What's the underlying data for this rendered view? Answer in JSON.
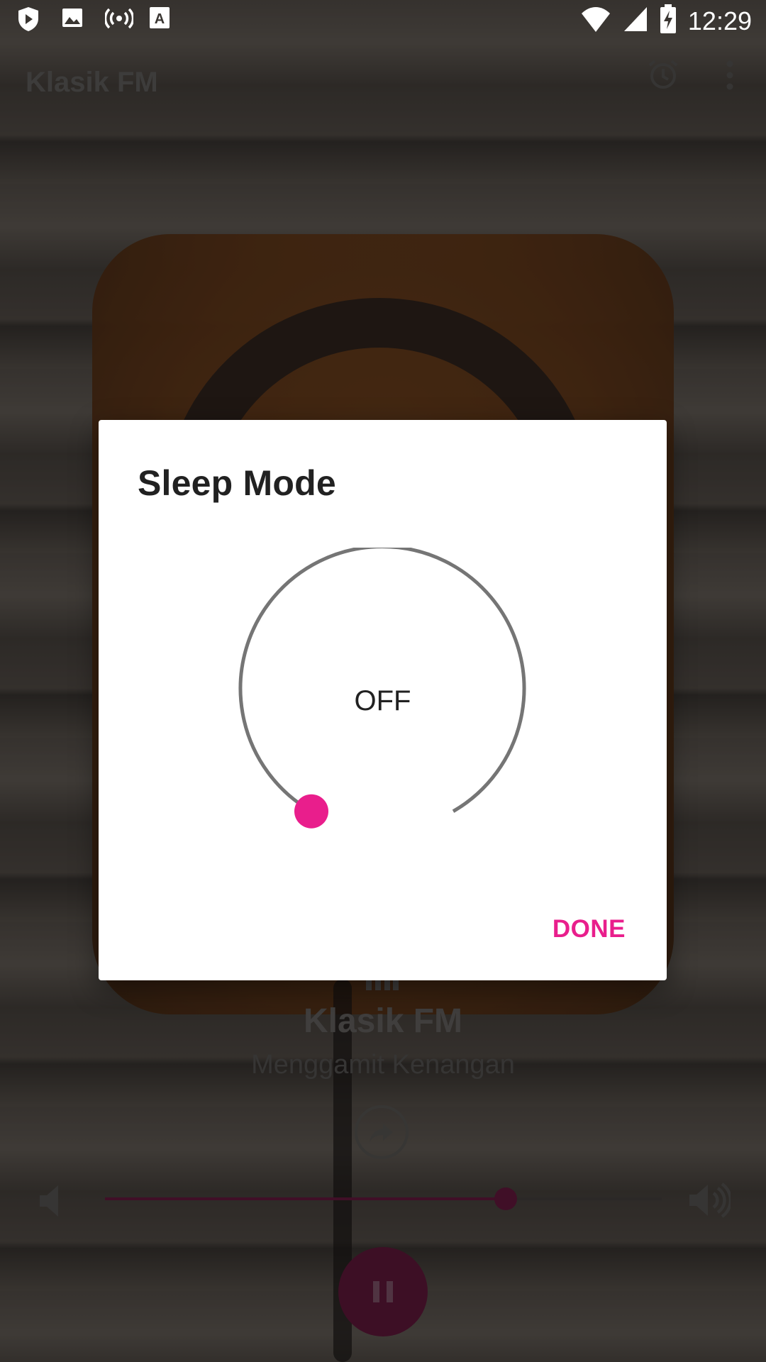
{
  "status_bar": {
    "time": "12:29",
    "left_icons": [
      "shield-play-icon",
      "image-icon",
      "radio-broadcast-icon",
      "keyboard-a-icon"
    ],
    "right_icons": [
      "wifi-icon",
      "cellular-signal-icon",
      "battery-charging-icon"
    ]
  },
  "toolbar": {
    "title": "Klasik FM",
    "icons": [
      "alarm-icon",
      "more-vert-icon"
    ]
  },
  "player": {
    "station_name": "Klasik FM",
    "subtitle": "Menggamit Kenangan",
    "volume_fraction": 0.72,
    "icons": [
      "share-icon",
      "volume-low-icon",
      "volume-high-icon",
      "pause-icon",
      "equalizer-bars-icon"
    ]
  },
  "dialog": {
    "title": "Sleep Mode",
    "dial_value": "OFF",
    "done_label": "DONE",
    "accent_color": "#E91E8C"
  },
  "colors": {
    "accent": "#E91E8C",
    "accent_dimmed": "#6E1A44",
    "dial_track": "#757575"
  }
}
